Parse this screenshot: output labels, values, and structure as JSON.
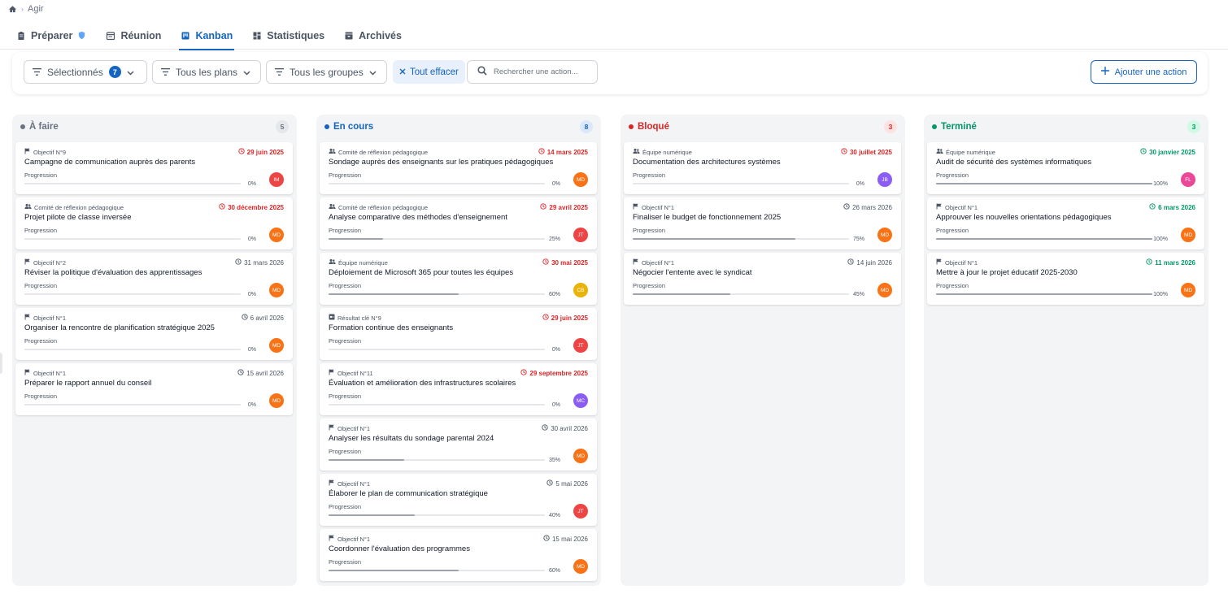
{
  "breadcrumb": {
    "home_icon": "home-icon",
    "current": "Agir"
  },
  "tabs": [
    {
      "label": "Préparer",
      "icon": "clipboard-icon"
    },
    {
      "label": "Réunion",
      "icon": "calendar-icon"
    },
    {
      "label": "Kanban",
      "icon": "kanban-icon",
      "active": true
    },
    {
      "label": "Statistiques",
      "icon": "dashboard-icon"
    },
    {
      "label": "Archivés",
      "icon": "archive-icon"
    }
  ],
  "filters": {
    "selected_label": "Sélectionnés",
    "selected_count": "7",
    "plans_label": "Tous les plans",
    "groups_label": "Tous les groupes",
    "clear_label": "Tout effacer",
    "search_placeholder": "Rechercher une action...",
    "add_label": "Ajouter une action"
  },
  "colors": {
    "accent": "#1565c0",
    "overdue": "#dc2626",
    "done": "#059669",
    "neutral": "#4b5563"
  },
  "columns": [
    {
      "title": "À faire",
      "count": "5",
      "color": "#6b7280",
      "badge_bg": "#e5e7eb",
      "cards": [
        {
          "source_icon": "flag-icon",
          "source": "Objectif N°9",
          "date": "29 juin 2025",
          "date_status": "overdue",
          "title": "Campagne de communication auprès des parents",
          "progress_label": "Progression",
          "progress": 0,
          "progress_text": "0%",
          "avatar": "IM",
          "avatar_color": "#ef4444"
        },
        {
          "source_icon": "group-icon",
          "source": "Comité de réflexion pédagogique",
          "date": "30 décembre 2025",
          "date_status": "overdue",
          "title": "Projet pilote de classe inversée",
          "progress_label": "Progression",
          "progress": 0,
          "progress_text": "0%",
          "avatar": "MD",
          "avatar_color": "#f97316"
        },
        {
          "source_icon": "flag-icon",
          "source": "Objectif N°2",
          "date": "31 mars 2026",
          "date_status": "normal",
          "title": "Réviser la politique d'évaluation des apprentissages",
          "progress_label": "Progression",
          "progress": 0,
          "progress_text": "0%",
          "avatar": "MD",
          "avatar_color": "#f97316"
        },
        {
          "source_icon": "flag-icon",
          "source": "Objectif N°1",
          "date": "6 avril 2026",
          "date_status": "normal",
          "title": "Organiser la rencontre de planification stratégique 2025",
          "progress_label": "Progression",
          "progress": 0,
          "progress_text": "0%",
          "avatar": "MD",
          "avatar_color": "#f97316"
        },
        {
          "source_icon": "flag-icon",
          "source": "Objectif N°1",
          "date": "15 avril 2026",
          "date_status": "normal",
          "title": "Préparer le rapport annuel du conseil",
          "progress_label": "Progression",
          "progress": 0,
          "progress_text": "0%",
          "avatar": "MD",
          "avatar_color": "#f97316"
        }
      ]
    },
    {
      "title": "En cours",
      "count": "8",
      "color": "#1565c0",
      "badge_bg": "#dbe7fb",
      "cards": [
        {
          "source_icon": "group-icon",
          "source": "Comité de réflexion pédagogique",
          "date": "14 mars 2025",
          "date_status": "overdue",
          "title": "Sondage auprès des enseignants sur les pratiques pédagogiques",
          "progress_label": "Progression",
          "progress": 0,
          "progress_text": "0%",
          "avatar": "MD",
          "avatar_color": "#f97316"
        },
        {
          "source_icon": "group-icon",
          "source": "Comité de réflexion pédagogique",
          "date": "29 avril 2025",
          "date_status": "overdue",
          "title": "Analyse comparative des méthodes d'enseignement",
          "progress_label": "Progression",
          "progress": 25,
          "progress_text": "25%",
          "avatar": "JT",
          "avatar_color": "#ef4444"
        },
        {
          "source_icon": "group-icon",
          "source": "Équipe numérique",
          "date": "30 mai 2025",
          "date_status": "overdue",
          "title": "Déploiement de Microsoft 365 pour toutes les équipes",
          "progress_label": "Progression",
          "progress": 60,
          "progress_text": "60%",
          "avatar": "CB",
          "avatar_color": "#eab308"
        },
        {
          "source_icon": "key-result-icon",
          "source": "Résultat clé N°9",
          "date": "29 juin 2025",
          "date_status": "overdue",
          "title": "Formation continue des enseignants",
          "progress_label": "Progression",
          "progress": 0,
          "progress_text": "0%",
          "avatar": "JT",
          "avatar_color": "#ef4444"
        },
        {
          "source_icon": "flag-icon",
          "source": "Objectif N°11",
          "date": "29 septembre 2025",
          "date_status": "overdue",
          "title": "Évaluation et amélioration des infrastructures scolaires",
          "progress_label": "Progression",
          "progress": 0,
          "progress_text": "0%",
          "avatar": "MC",
          "avatar_color": "#8b5cf6"
        },
        {
          "source_icon": "flag-icon",
          "source": "Objectif N°1",
          "date": "30 avril 2026",
          "date_status": "normal",
          "title": "Analyser les résultats du sondage parental 2024",
          "progress_label": "Progression",
          "progress": 35,
          "progress_text": "35%",
          "avatar": "MD",
          "avatar_color": "#f97316"
        },
        {
          "source_icon": "flag-icon",
          "source": "Objectif N°1",
          "date": "5 mai 2026",
          "date_status": "normal",
          "title": "Élaborer le plan de communication stratégique",
          "progress_label": "Progression",
          "progress": 40,
          "progress_text": "40%",
          "avatar": "JT",
          "avatar_color": "#ef4444"
        },
        {
          "source_icon": "flag-icon",
          "source": "Objectif N°1",
          "date": "15 mai 2026",
          "date_status": "normal",
          "title": "Coordonner l'évaluation des programmes",
          "progress_label": "Progression",
          "progress": 60,
          "progress_text": "60%",
          "avatar": "MD",
          "avatar_color": "#f97316"
        }
      ]
    },
    {
      "title": "Bloqué",
      "count": "3",
      "color": "#dc2626",
      "badge_bg": "#fde2e2",
      "cards": [
        {
          "source_icon": "group-icon",
          "source": "Équipe numérique",
          "date": "30 juillet 2025",
          "date_status": "overdue",
          "title": "Documentation des architectures systèmes",
          "progress_label": "Progression",
          "progress": 0,
          "progress_text": "0%",
          "avatar": "JB",
          "avatar_color": "#8b5cf6"
        },
        {
          "source_icon": "flag-icon",
          "source": "Objectif N°1",
          "date": "26 mars 2026",
          "date_status": "normal",
          "title": "Finaliser le budget de fonctionnement 2025",
          "progress_label": "Progression",
          "progress": 75,
          "progress_text": "75%",
          "avatar": "MD",
          "avatar_color": "#f97316"
        },
        {
          "source_icon": "flag-icon",
          "source": "Objectif N°1",
          "date": "14 juin 2026",
          "date_status": "normal",
          "title": "Négocier l'entente avec le syndicat",
          "progress_label": "Progression",
          "progress": 45,
          "progress_text": "45%",
          "avatar": "MD",
          "avatar_color": "#f97316"
        }
      ]
    },
    {
      "title": "Terminé",
      "count": "3",
      "color": "#059669",
      "badge_bg": "#d1fae5",
      "cards": [
        {
          "source_icon": "group-icon",
          "source": "Équipe numérique",
          "date": "30 janvier 2025",
          "date_status": "done",
          "title": "Audit de sécurité des systèmes informatiques",
          "progress_label": "Progression",
          "progress": 100,
          "progress_text": "100%",
          "avatar": "FL",
          "avatar_color": "#ec4899"
        },
        {
          "source_icon": "flag-icon",
          "source": "Objectif N°1",
          "date": "6 mars 2026",
          "date_status": "done",
          "title": "Approuver les nouvelles orientations pédagogiques",
          "progress_label": "Progression",
          "progress": 100,
          "progress_text": "100%",
          "avatar": "MD",
          "avatar_color": "#f97316"
        },
        {
          "source_icon": "flag-icon",
          "source": "Objectif N°1",
          "date": "11 mars 2026",
          "date_status": "done",
          "title": "Mettre à jour le projet éducatif 2025-2030",
          "progress_label": "Progression",
          "progress": 100,
          "progress_text": "100%",
          "avatar": "MD",
          "avatar_color": "#f97316"
        }
      ]
    }
  ]
}
